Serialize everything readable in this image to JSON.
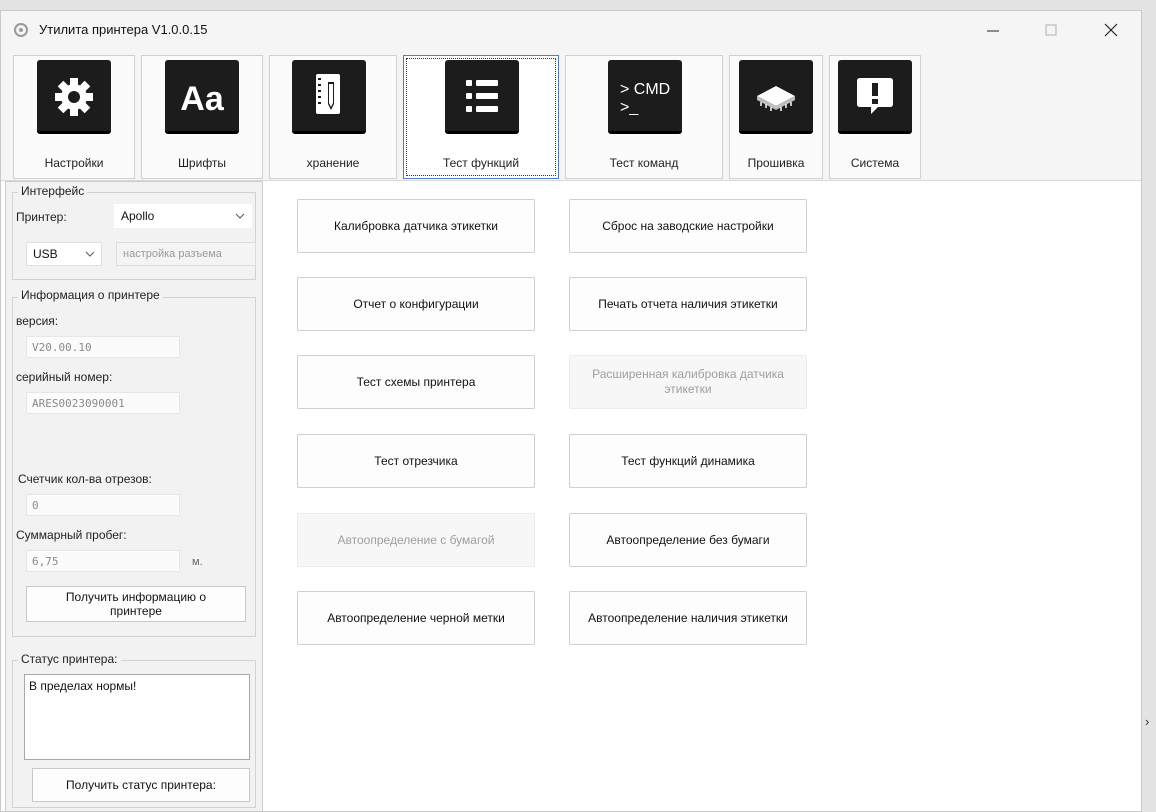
{
  "window": {
    "title": "Утилита принтера  V1.0.0.15",
    "controls": {
      "minimize": "minimize-icon",
      "maximize": "maximize-icon",
      "close": "close-icon"
    }
  },
  "tabs": [
    {
      "label": "Настройки",
      "icon": "gear-icon"
    },
    {
      "label": "Шрифты",
      "icon": "font-icon",
      "icon_text": "Aa"
    },
    {
      "label": "хранение",
      "icon": "notebook-pencil-icon"
    },
    {
      "label": "Тест функций",
      "icon": "list-icon",
      "active": true
    },
    {
      "label": "Тест команд",
      "icon": "cmd-icon",
      "icon_text_1": "> CMD",
      "icon_text_2": ">_"
    },
    {
      "label": "Прошивка",
      "icon": "chip-icon"
    },
    {
      "label": "Система",
      "icon": "alert-icon"
    }
  ],
  "interface": {
    "title": "Интерфейс",
    "printer_label": "Принтер:",
    "printer_value": "Apollo",
    "port_value": "USB",
    "port_settings_label": "настройка разъема"
  },
  "printer_info": {
    "title": "Информация о принтере",
    "version_label": "версия:",
    "version_value": "V20.00.10",
    "serial_label": "серийный номер:",
    "serial_value": "ARES0023090001",
    "cut_counter_label": "Счетчик кол-ва отрезов:",
    "cut_counter_value": "0",
    "mileage_label": "Суммарный пробег:",
    "mileage_value": "6,75",
    "mileage_unit": "м.",
    "get_info_button": "Получить информацию о принтере"
  },
  "status": {
    "title": "Статус принтера:",
    "text": "В пределах нормы!",
    "get_status_button": "Получить статус принтера:"
  },
  "function_buttons": {
    "left": [
      {
        "label": "Калибровка датчика этикетки",
        "enabled": true
      },
      {
        "label": "Отчет о конфигурации",
        "enabled": true
      },
      {
        "label": "Тест схемы принтера",
        "enabled": true
      },
      {
        "label": "Тест отрезчика",
        "enabled": true
      },
      {
        "label": "Автоопределение с бумагой",
        "enabled": false
      },
      {
        "label": "Автоопределение черной метки",
        "enabled": true
      }
    ],
    "right": [
      {
        "label": "Сброс на заводские настройки",
        "enabled": true
      },
      {
        "label": "Печать отчета наличия этикетки",
        "enabled": true
      },
      {
        "label": "Расширенная калибровка датчика этикетки",
        "enabled": false
      },
      {
        "label": "Тест функций динамика",
        "enabled": true
      },
      {
        "label": "Автоопределение без бумаги",
        "enabled": true
      },
      {
        "label": "Автоопределение наличия этикетки",
        "enabled": true
      }
    ]
  },
  "colors": {
    "accent_border": "#4f7ec9",
    "icon_tile": "#1c1c1c",
    "disabled_text": "#9e9e9e"
  }
}
